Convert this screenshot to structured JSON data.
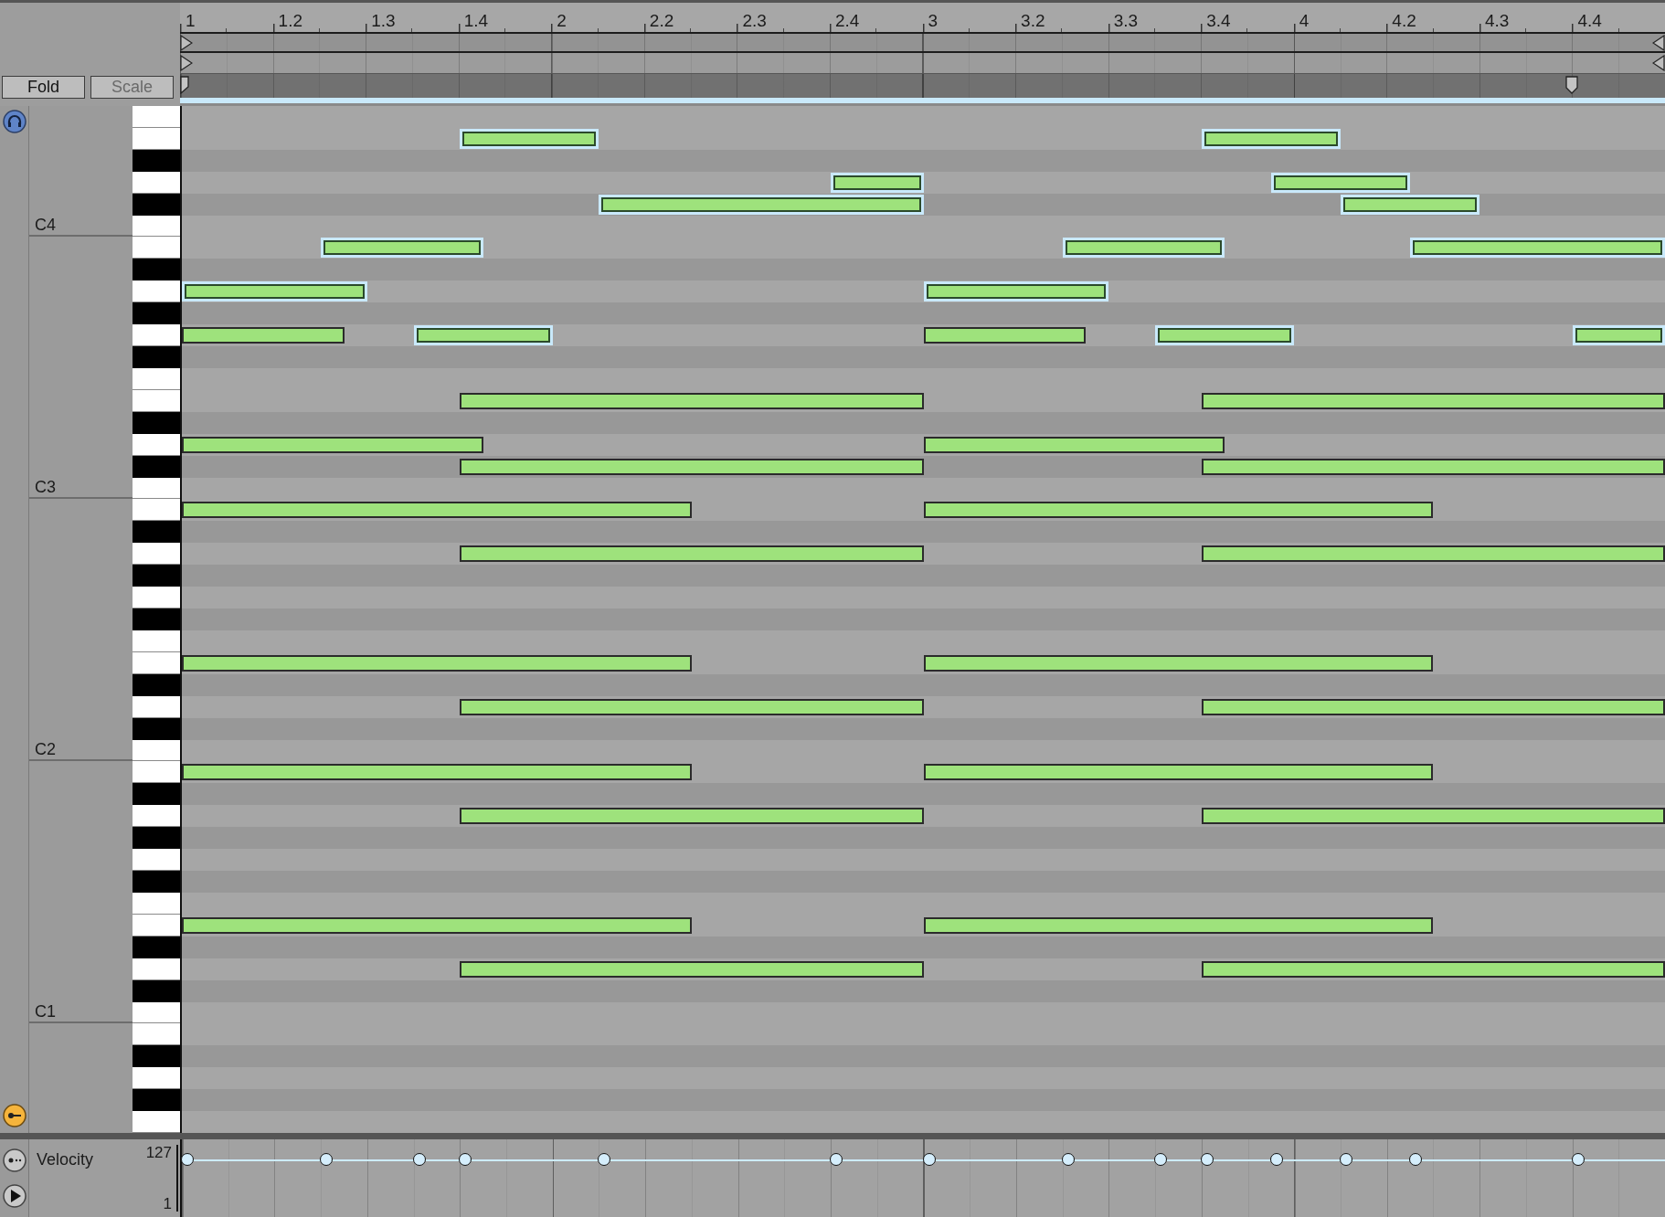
{
  "toolbar": {
    "buttons": [
      {
        "label": "Fold",
        "disabled": false
      },
      {
        "label": "Scale",
        "disabled": true
      }
    ]
  },
  "ruler": {
    "labels": [
      "1",
      "1.2",
      "1.3",
      "1.4",
      "2",
      "2.2",
      "2.3",
      "2.4",
      "3",
      "3.2",
      "3.3",
      "3.4",
      "4",
      "4.2",
      "4.3",
      "4.4"
    ]
  },
  "lanes": [
    {
      "black": false
    },
    {
      "black": false,
      "notes": [
        {
          "selected": true
        },
        {
          "selected": true
        }
      ]
    },
    {
      "black": true
    },
    {
      "black": false,
      "notes": [
        {
          "selected": true
        },
        {
          "selected": true
        }
      ]
    },
    {
      "black": true,
      "notes": [
        {
          "selected": true
        },
        {
          "selected": true
        }
      ]
    },
    {
      "black": false,
      "octave_label": "C4"
    },
    {
      "black": false,
      "notes": [
        {
          "selected": true
        },
        {
          "selected": true
        },
        {
          "selected": true
        }
      ]
    },
    {
      "black": true
    },
    {
      "black": false,
      "notes": [
        {
          "selected": true
        },
        {
          "selected": true
        }
      ]
    },
    {
      "black": true
    },
    {
      "black": false,
      "notes": [
        {
          "selected": false
        },
        {
          "selected": true
        },
        {
          "selected": false
        },
        {
          "selected": true
        },
        {
          "selected": true
        }
      ]
    },
    {
      "black": true
    },
    {
      "black": false
    },
    {
      "black": false,
      "notes": [
        {
          "selected": false
        },
        {
          "selected": false
        }
      ]
    },
    {
      "black": true
    },
    {
      "black": false,
      "notes": [
        {
          "selected": false
        },
        {
          "selected": false
        }
      ]
    },
    {
      "black": true,
      "notes": [
        {
          "selected": false
        },
        {
          "selected": false
        }
      ]
    },
    {
      "black": false,
      "octave_label": "C3"
    },
    {
      "black": false,
      "notes": [
        {
          "selected": false
        },
        {
          "selected": false
        }
      ]
    },
    {
      "black": true
    },
    {
      "black": false,
      "notes": [
        {
          "selected": false
        },
        {
          "selected": false
        }
      ]
    },
    {
      "black": true
    },
    {
      "black": false
    },
    {
      "black": true
    },
    {
      "black": false
    },
    {
      "black": false,
      "notes": [
        {
          "selected": false
        },
        {
          "selected": false
        }
      ]
    },
    {
      "black": true
    },
    {
      "black": false,
      "notes": [
        {
          "selected": false
        },
        {
          "selected": false
        }
      ]
    },
    {
      "black": true
    },
    {
      "black": false,
      "octave_label": "C2"
    },
    {
      "black": false,
      "notes": [
        {
          "selected": false
        },
        {
          "selected": false
        }
      ]
    },
    {
      "black": true
    },
    {
      "black": false,
      "notes": [
        {
          "selected": false
        },
        {
          "selected": false
        }
      ]
    },
    {
      "black": true
    },
    {
      "black": false
    },
    {
      "black": true
    },
    {
      "black": false
    },
    {
      "black": false,
      "notes": [
        {
          "selected": false
        },
        {
          "selected": false
        }
      ]
    },
    {
      "black": true
    },
    {
      "black": false,
      "notes": [
        {
          "selected": false
        },
        {
          "selected": false
        }
      ]
    },
    {
      "black": true
    },
    {
      "black": false,
      "octave_label": "C1"
    },
    {
      "black": false
    },
    {
      "black": true
    },
    {
      "black": false
    },
    {
      "black": true
    },
    {
      "black": false
    }
  ],
  "velocity": {
    "title": "Velocity",
    "max_label": "127",
    "min_label": "1"
  }
}
